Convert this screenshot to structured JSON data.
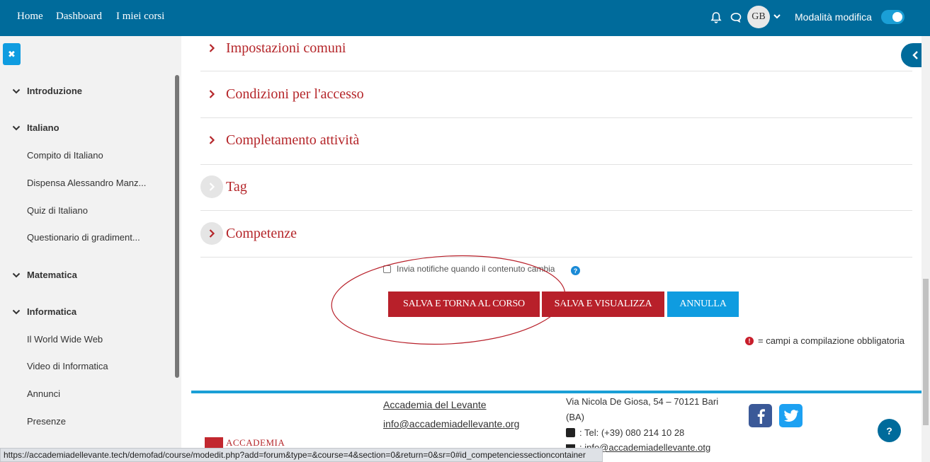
{
  "navbar": {
    "links": [
      "Home",
      "Dashboard",
      "I miei corsi"
    ],
    "avatar_initials": "GB",
    "edit_mode_label": "Modalità modifica",
    "edit_mode_on": true
  },
  "drawer": {
    "sections": [
      {
        "title": "Introduzione",
        "items": []
      },
      {
        "title": "Italiano",
        "items": [
          "Compito di Italiano",
          "Dispensa Alessandro Manz...",
          "Quiz di Italiano",
          "Questionario di gradiment..."
        ]
      },
      {
        "title": "Matematica",
        "items": []
      },
      {
        "title": "Informatica",
        "items": [
          "Il World Wide Web",
          "Video di Informatica",
          "Annunci",
          "Presenze"
        ]
      }
    ]
  },
  "form": {
    "sections": [
      "Impostazioni comuni",
      "Condizioni per l'accesso",
      "Completamento attività",
      "Tag",
      "Competenze"
    ],
    "notify_label": "Invia notifiche quando il contenuto cambia",
    "buttons": {
      "save_return": "SALVA E TORNA AL CORSO",
      "save_display": "SALVA E VISUALIZZA",
      "cancel": "ANNULLA"
    },
    "required_note": "= campi a compilazione obbligatoria"
  },
  "footer": {
    "name": "Accademia del Levante",
    "email": "info@accademiadellevante.org",
    "address": "Via Nicola De Giosa, 54 – 70121 Bari",
    "address_2": "(BA)",
    "tel": ": Tel: (+39) 080 214 10 28",
    "email_2": ": info@accademiadellevante.otg",
    "logo_word": "ACCADEMIA"
  },
  "status_url": "https://accademiadellevante.tech/demofad/course/modedit.php?add=forum&type=&course=4&section=0&return=0&sr=0#id_competenciessectioncontainer",
  "colors": {
    "navbar": "#006b9b",
    "accent_red": "#b8202a",
    "accent_blue": "#0f9ce0"
  }
}
